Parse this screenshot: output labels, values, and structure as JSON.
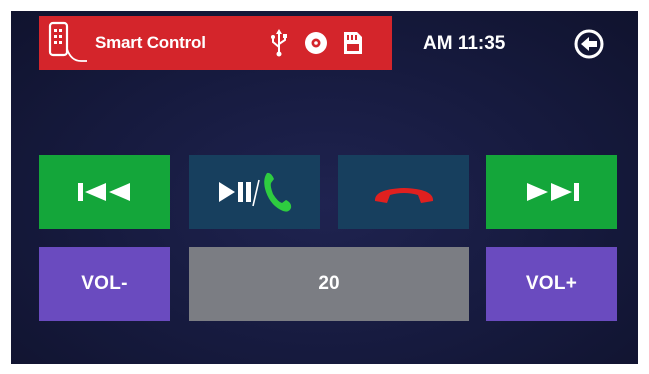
{
  "status_bar": {
    "app_title": "Smart Control",
    "accent_color": "#d4252b",
    "icons": [
      "phone-icon",
      "usb-icon",
      "disc-icon",
      "sd-card-icon"
    ]
  },
  "clock": {
    "time": "AM 11:35"
  },
  "controls": {
    "prev_icon": "skip-previous-icon",
    "play_pause_icon": "play-pause-icon",
    "answer_call_icon": "phone-answer-icon",
    "hang_up_icon": "phone-hangup-icon",
    "next_icon": "skip-next-icon",
    "vol_down_label": "VOL-",
    "vol_up_label": "VOL+",
    "volume_value": "20"
  },
  "colors": {
    "green_button": "#14a63a",
    "teal_button": "#173f5e",
    "purple_button": "#6a4bbf",
    "volume_display": "#7b7d83",
    "answer_green": "#2ecc40",
    "hangup_red": "#e0201f"
  }
}
